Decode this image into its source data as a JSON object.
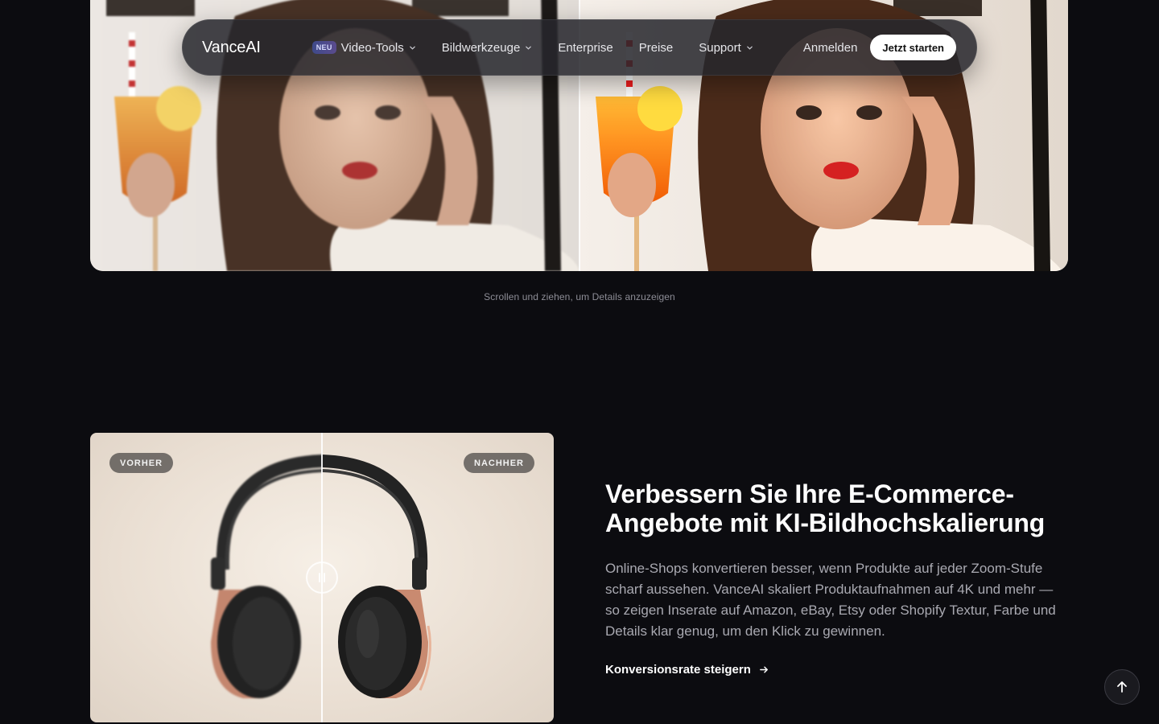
{
  "nav": {
    "logo": "VanceAI",
    "items": [
      {
        "label": "Video-Tools",
        "badge": "NEU",
        "has_dropdown": true
      },
      {
        "label": "Bildwerkzeuge",
        "has_dropdown": true
      },
      {
        "label": "Enterprise",
        "has_dropdown": false
      },
      {
        "label": "Preise",
        "has_dropdown": false
      },
      {
        "label": "Support",
        "has_dropdown": true
      }
    ],
    "signin": "Anmelden",
    "cta": "Jetzt starten"
  },
  "hero": {
    "scroll_hint": "Scrollen und ziehen, um Details anzuzeigen"
  },
  "product": {
    "before_label": "VORHER",
    "after_label": "NACHHER"
  },
  "section": {
    "heading": "Verbessern Sie Ihre E-Commerce-Angebote mit KI-Bildhochskalierung",
    "body": "Online-Shops konvertieren besser, wenn Produkte auf jeder Zoom-Stufe scharf aussehen. VanceAI skaliert Produktaufnahmen auf 4K und mehr — so zeigen Inserate auf Amazon, eBay, Etsy oder Shopify Textur, Farbe und Details klar genug, um den Klick zu gewinnen.",
    "link": "Konversionsrate steigern"
  },
  "colors": {
    "background": "#0c0c10",
    "nav_bg": "#26262c",
    "cta_bg": "#ffffff",
    "muted_text": "#a9a9b1"
  },
  "icons": [
    "chevron-down-icon",
    "arrow-right-icon",
    "arrow-up-icon",
    "pause-handle-icon"
  ]
}
